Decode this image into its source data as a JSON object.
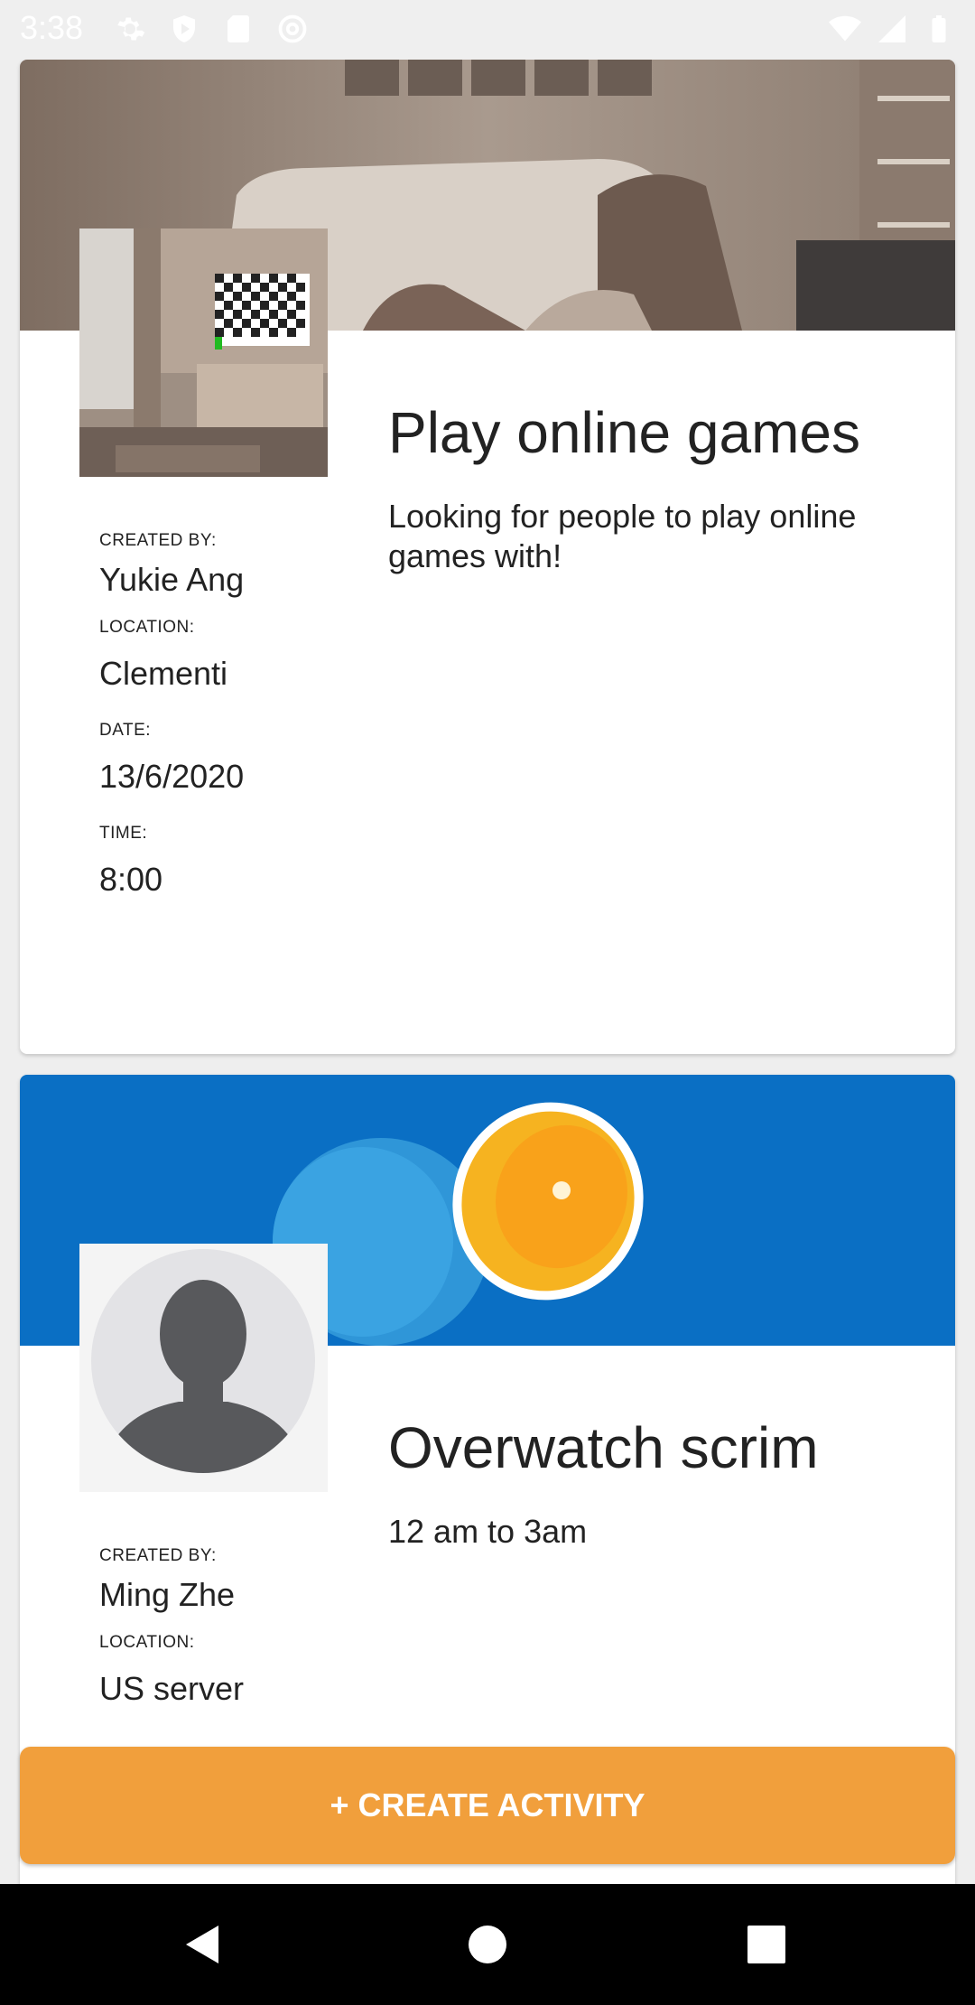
{
  "status_bar": {
    "time": "3:38",
    "left_icons": [
      "gear-icon",
      "play-protect-icon",
      "sd-card-icon",
      "at-sign-icon"
    ],
    "right_icons": [
      "wifi-icon",
      "signal-icon",
      "battery-icon"
    ]
  },
  "activities": [
    {
      "title": "Play online games",
      "description": "Looking for people to play online games with!",
      "created_by_label": "CREATED BY:",
      "created_by": "Yukie Ang",
      "location_label": "LOCATION:",
      "location": "Clementi",
      "date_label": "DATE:",
      "date": "13/6/2020",
      "time_label": "TIME:",
      "time": "8:00"
    },
    {
      "title": "Overwatch scrim",
      "description": "12 am to 3am",
      "created_by_label": "CREATED BY:",
      "created_by": "Ming Zhe",
      "location_label": "LOCATION:",
      "location": "US server"
    }
  ],
  "create_button": {
    "label": "+ CREATE ACTIVITY"
  },
  "colors": {
    "accent": "#f19f3c",
    "banner_blue": "#0a6fc4",
    "banner_beige": "#a8968a"
  }
}
